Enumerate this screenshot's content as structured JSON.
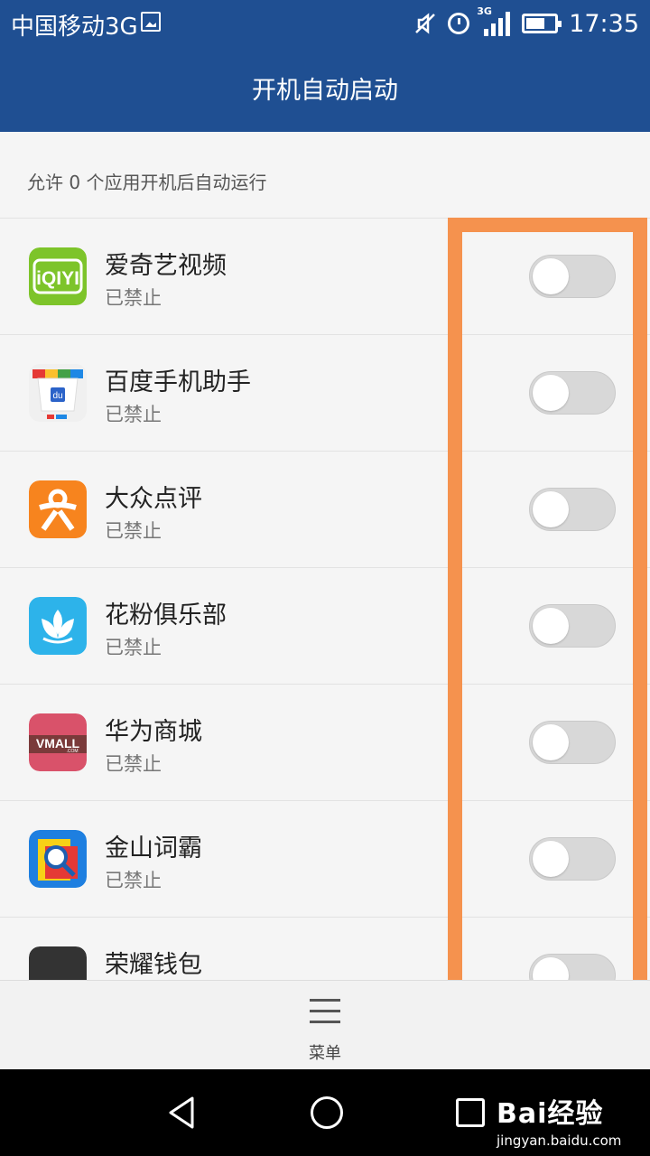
{
  "status_bar": {
    "carrier": "中国移动3G",
    "network_tag": "3G",
    "time": "17:35",
    "icons": [
      "image-icon",
      "mute-icon",
      "alarm-icon",
      "signal-icon",
      "battery-icon"
    ]
  },
  "header": {
    "title": "开机自动启动",
    "background": "#1f4f92"
  },
  "summary": "允许 0 个应用开机后自动运行",
  "apps": [
    {
      "name": "爱奇艺视频",
      "status": "已禁止",
      "enabled": false
    },
    {
      "name": "百度手机助手",
      "status": "已禁止",
      "enabled": false
    },
    {
      "name": "大众点评",
      "status": "已禁止",
      "enabled": false
    },
    {
      "name": "花粉俱乐部",
      "status": "已禁止",
      "enabled": false
    },
    {
      "name": "华为商城",
      "status": "已禁止",
      "enabled": false
    },
    {
      "name": "金山词霸",
      "status": "已禁止",
      "enabled": false
    },
    {
      "name": "荣耀钱包",
      "enabled": false
    }
  ],
  "app_icon_text": {
    "iqiyi": "iQIYI",
    "vmall": "VMALL",
    "vmall_sub": ".COM",
    "baidu": "du"
  },
  "highlight_color": "#f5924e",
  "menu": {
    "label": "菜单"
  },
  "watermark": {
    "brand": "Bai经验",
    "url": "jingyan.baidu.com"
  }
}
